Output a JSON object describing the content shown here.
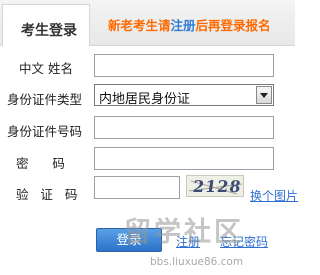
{
  "header": {
    "tab_title": "考生登录",
    "note_prefix": "新老考生请",
    "register_link": "注册",
    "note_suffix": "后再登录报名"
  },
  "form": {
    "name_label": "中文 姓名",
    "id_type_label": "身份证件类型",
    "id_type_value": "内地居民身份证",
    "id_number_label": "身份证件号码",
    "password_label": "密      码",
    "captcha_label": "验   证   码",
    "captcha_image_text": "2128",
    "refresh_captcha": "换个图片"
  },
  "actions": {
    "login": "登录",
    "register": "注册",
    "forgot": "忘记密码"
  },
  "watermark": {
    "text": "留学社区",
    "url": "bbs.liuxue86.com"
  },
  "colors": {
    "accent_orange": "#ff6a00",
    "link_blue": "#2f7cd8",
    "button_blue": "#2d73c8"
  }
}
